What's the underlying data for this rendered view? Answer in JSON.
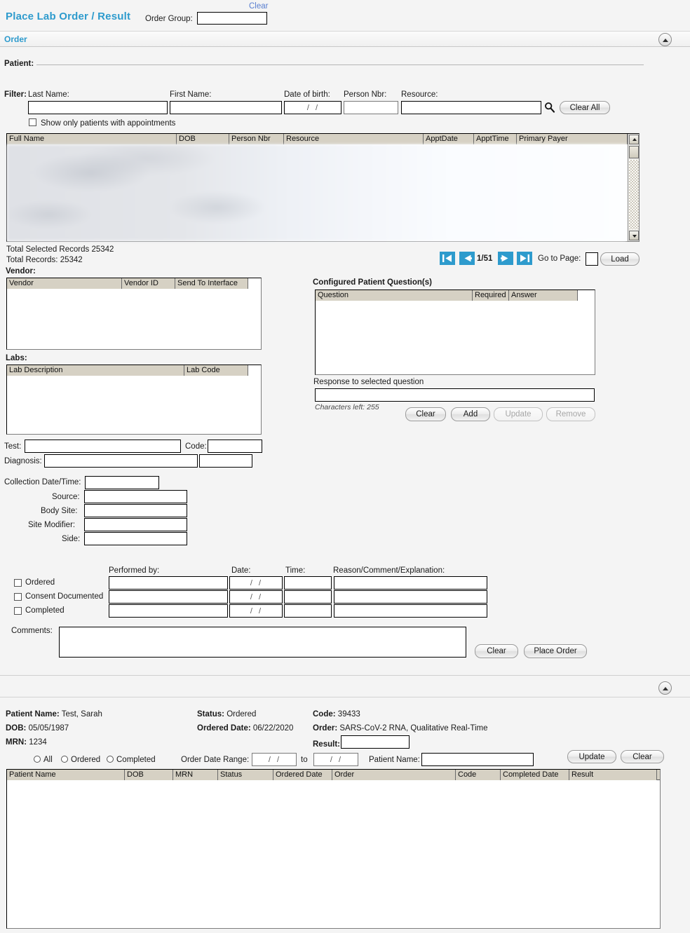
{
  "header": {
    "app_title": "Place Lab Order / Result",
    "order_group_label": "Order Group:",
    "order_group_value": "",
    "clear_link": "Clear"
  },
  "section": {
    "order_label": "Order",
    "collapse_icon": "chevron-up-icon"
  },
  "patient_group": {
    "legend": "Patient:",
    "filter_label": "Filter:",
    "fields": {
      "last_name_label": "Last Name:",
      "last_name_value": "",
      "first_name_label": "First Name:",
      "first_name_value": "",
      "dob_label": "Date of birth:",
      "dob_value": "/  /",
      "person_nbr_label": "Person Nbr:",
      "person_nbr_value": "",
      "resource_label": "Resource:",
      "resource_value": ""
    },
    "search_icon": "search-icon",
    "clear_all_button": "Clear All",
    "show_appts_checkbox": "Show only patients with appointments",
    "grid_columns": [
      "Full Name",
      "DOB",
      "Person Nbr",
      "Resource",
      "ApptDate",
      "ApptTime",
      "Primary Payer"
    ],
    "grid_rows": [],
    "total_selected_records": "Total Selected Records 25342",
    "total_records": "Total Records: 25342"
  },
  "pager": {
    "first_icon": "first-page-icon",
    "prev_icon": "previous-page-icon",
    "page_count": "1/51",
    "next_icon": "next-page-icon",
    "last_icon": "last-page-icon",
    "goto_label": "Go to Page:",
    "goto_value": "",
    "load_button": "Load"
  },
  "vendor": {
    "legend": "Vendor:",
    "columns": [
      "Vendor",
      "Vendor ID",
      "Send To Interface"
    ],
    "rows": []
  },
  "labs": {
    "legend": "Labs:",
    "columns": [
      "Lab Description",
      "Lab Code"
    ],
    "rows": []
  },
  "questions": {
    "legend": "Configured Patient Question(s)",
    "columns": [
      "Question",
      "Required",
      "Answer"
    ],
    "rows": [],
    "response_label": "Response to selected question",
    "response_value": "",
    "characters_left": "Characters left: 255",
    "buttons": {
      "clear": "Clear",
      "add": "Add",
      "update": "Update",
      "remove": "Remove"
    }
  },
  "order_details": {
    "test_label": "Test:",
    "test_value": "",
    "code_label": "Code:",
    "code_value": "",
    "diagnosis_label": "Diagnosis:",
    "diagnosis_value": "",
    "diagnosis_code_value": "",
    "collection_label": "Collection Date/Time:",
    "collection_value": "",
    "source_label": "Source:",
    "source_value": "",
    "body_site_label": "Body Site:",
    "body_site_value": "",
    "site_modifier_label": "Site Modifier:",
    "site_modifier_value": "",
    "side_label": "Side:",
    "side_value": ""
  },
  "status_grid": {
    "col_performed_by": "Performed by:",
    "col_date": "Date:",
    "col_time": "Time:",
    "col_reason": "Reason/Comment/Explanation:",
    "rows": [
      {
        "label": "Ordered",
        "checked": false,
        "performed_by": "",
        "date": "/  /",
        "time": "",
        "reason": ""
      },
      {
        "label": "Consent Documented",
        "checked": false,
        "performed_by": "",
        "date": "/  /",
        "time": "",
        "reason": ""
      },
      {
        "label": "Completed",
        "checked": false,
        "performed_by": "",
        "date": "/  /",
        "time": "",
        "reason": ""
      }
    ]
  },
  "comments": {
    "label": "Comments:",
    "value": "",
    "clear_button": "Clear",
    "place_order_button": "Place Order"
  },
  "result_panel": {
    "collapse_icon": "chevron-up-icon",
    "patient_name_label": "Patient Name:",
    "patient_name_value": "Test, Sarah",
    "dob_label": "DOB:",
    "dob_value": "05/05/1987",
    "mrn_label": "MRN:",
    "mrn_value": "1234",
    "status_label": "Status:",
    "status_value": "Ordered",
    "ordered_date_label": "Ordered Date:",
    "ordered_date_value": "06/22/2020",
    "code_label": "Code:",
    "code_value": "39433",
    "order_label": "Order:",
    "order_value": "SARS-CoV-2 RNA, Qualitative Real-Time",
    "result_label": "Result:",
    "result_value": "",
    "update_button": "Update",
    "clear_button": "Clear",
    "radios": [
      "All",
      "Ordered",
      "Completed"
    ],
    "date_range_label": "Order Date Range:",
    "date_from_value": "/  /",
    "date_to_word": "to",
    "date_to_value": "/  /",
    "patient_name_filter_label": "Patient Name:",
    "patient_name_filter_value": "",
    "columns": [
      "Patient Name",
      "DOB",
      "MRN",
      "Status",
      "Ordered Date",
      "Order",
      "Code",
      "Completed Date",
      "Result"
    ],
    "rows": []
  },
  "colors": {
    "accent": "#2e9bcd",
    "link": "#5a7fd0",
    "grid_header": "#d6d1c4",
    "page_bg": "#f4f4f4"
  }
}
